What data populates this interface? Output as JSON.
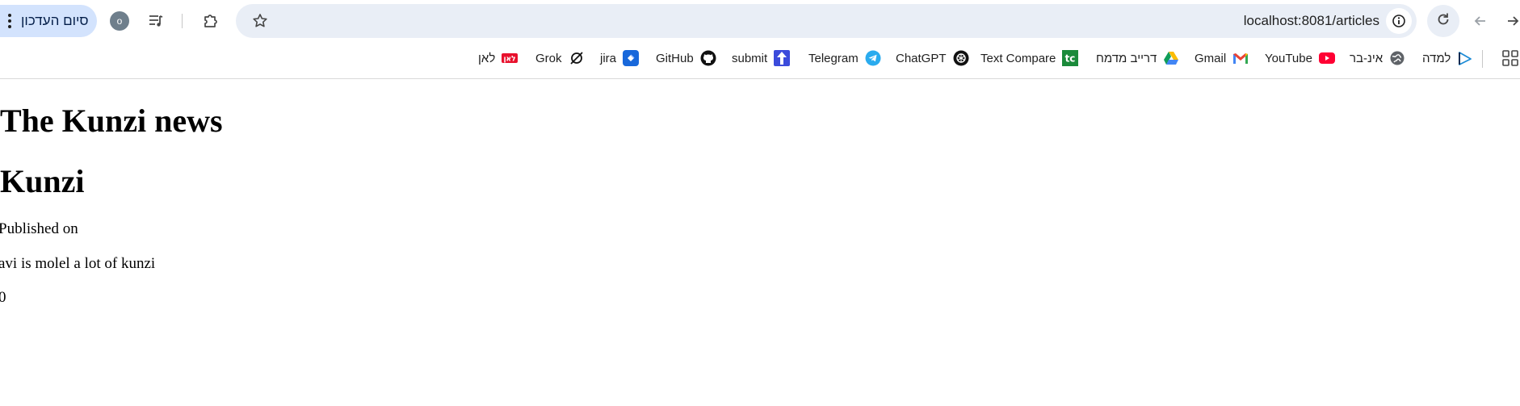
{
  "toolbar": {
    "update_button_label": "סיום העדכון",
    "profile_initial": "o",
    "url": "localhost:8081/articles"
  },
  "bookmarks": [
    {
      "label": "לאן",
      "icon": "laan-icon"
    },
    {
      "label": "Grok",
      "icon": "grok-icon"
    },
    {
      "label": "jira",
      "icon": "jira-icon"
    },
    {
      "label": "GitHub",
      "icon": "github-icon"
    },
    {
      "label": "submit",
      "icon": "submit-icon"
    },
    {
      "label": "Telegram",
      "icon": "telegram-icon"
    },
    {
      "label": "ChatGPT",
      "icon": "chatgpt-icon"
    },
    {
      "label": "Text Compare",
      "icon": "text-compare-icon"
    },
    {
      "label": "דרייב מדמח",
      "icon": "google-drive-icon"
    },
    {
      "label": "Gmail",
      "icon": "gmail-icon"
    },
    {
      "label": "YouTube",
      "icon": "youtube-icon"
    },
    {
      "label": "אינ-בר",
      "icon": "globe-icon"
    },
    {
      "label": "למדה",
      "icon": "lamda-icon"
    }
  ],
  "page": {
    "site_title": "The Kunzi news",
    "article_title": "Kunzi",
    "published": "Published on",
    "body": "avi is molel a lot of kunzi",
    "count": "0"
  },
  "colors": {
    "update_button_bg": "#d3e3fd",
    "omnibox_bg": "#e9eef6",
    "youtube_red": "#ff0033",
    "telegram_blue": "#2aabee",
    "jira_blue": "#1868db",
    "text_compare_green": "#1a8a3a"
  }
}
